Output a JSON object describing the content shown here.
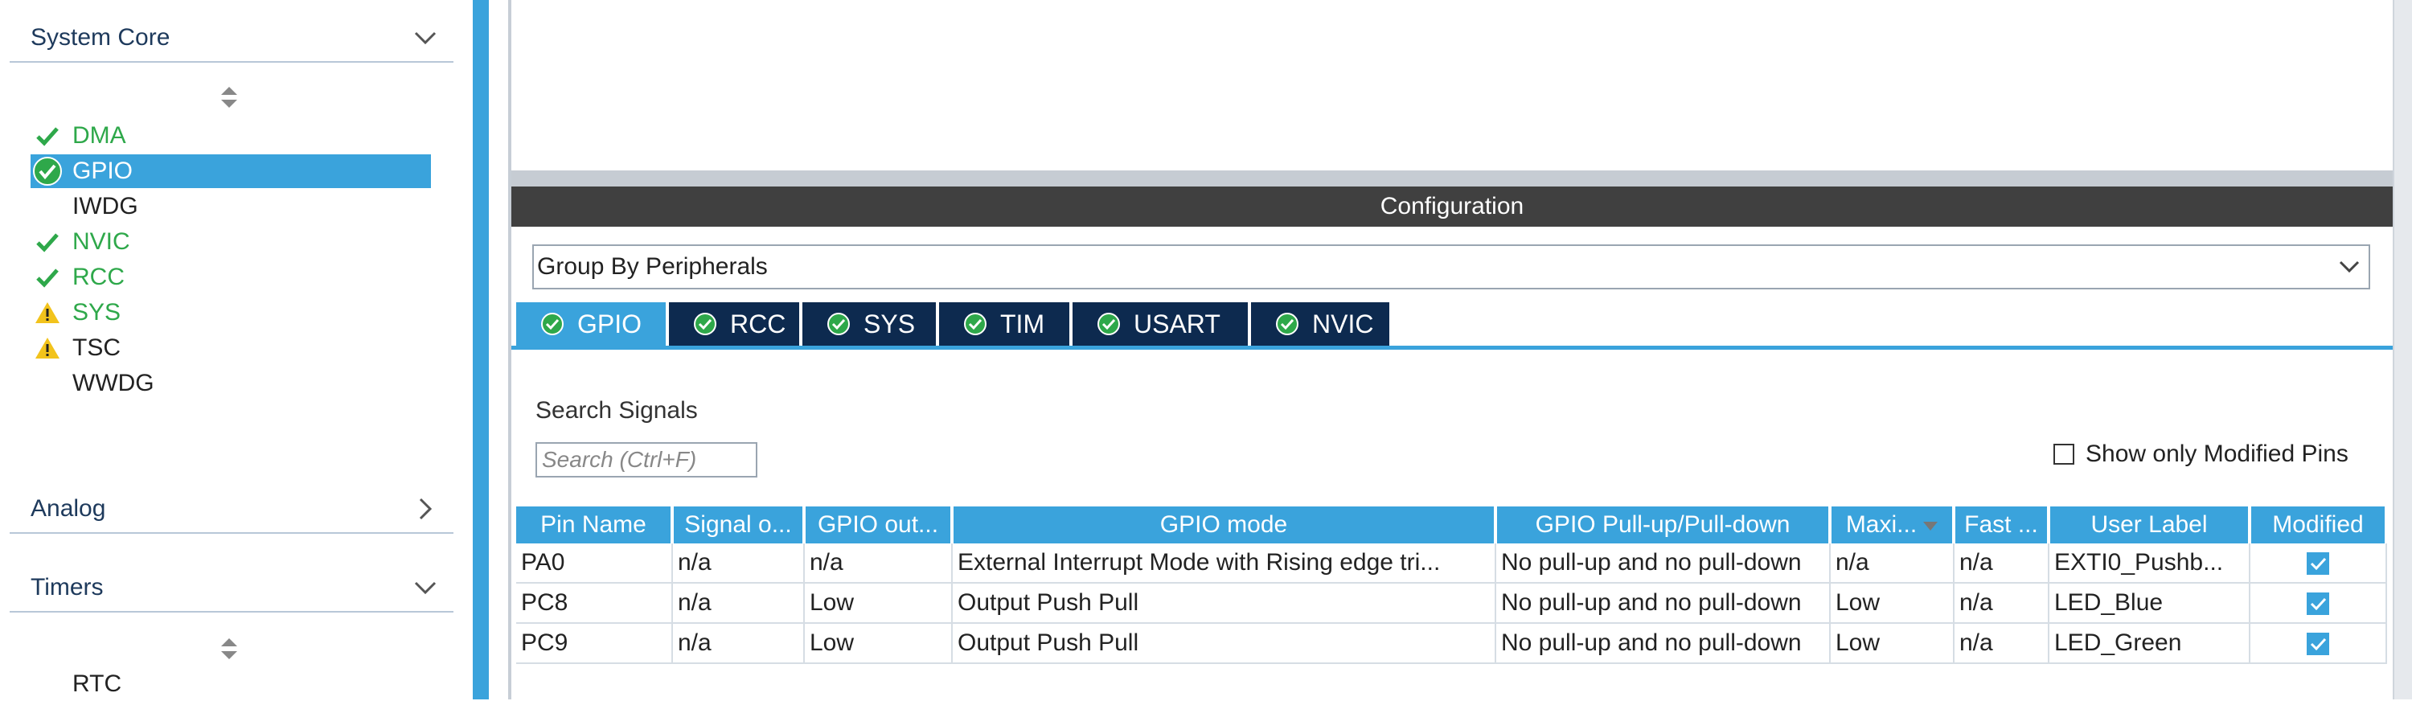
{
  "sidebar": {
    "categories": [
      {
        "label": "System Core",
        "chevron": "chevron-down-icon"
      },
      {
        "label": "Analog",
        "chevron": "chevron-right-icon"
      },
      {
        "label": "Timers",
        "chevron": "chevron-down-icon"
      }
    ],
    "system_core_items": [
      {
        "label": "DMA",
        "status": "check",
        "color": "#2ea84a"
      },
      {
        "label": "GPIO",
        "status": "check-circle",
        "selected": true
      },
      {
        "label": "IWDG",
        "status": "none"
      },
      {
        "label": "NVIC",
        "status": "check",
        "color": "#2ea84a"
      },
      {
        "label": "RCC",
        "status": "check",
        "color": "#2ea84a"
      },
      {
        "label": "SYS",
        "status": "warning",
        "color": "#2ea84a"
      },
      {
        "label": "TSC",
        "status": "warning"
      },
      {
        "label": "WWDG",
        "status": "none"
      }
    ],
    "timers_items": [
      {
        "label": "RTC",
        "status": "none"
      }
    ]
  },
  "config": {
    "title": "Configuration",
    "group_by": "Group By Peripherals",
    "tabs": [
      "GPIO",
      "RCC",
      "SYS",
      "TIM",
      "USART",
      "NVIC"
    ],
    "active_tab": "GPIO",
    "search_label": "Search Signals",
    "search_placeholder": "Search (Ctrl+F)",
    "modified_only_label": "Show only Modified Pins"
  },
  "table": {
    "headers": [
      "Pin Name",
      "Signal o...",
      "GPIO out...",
      "GPIO mode",
      "GPIO Pull-up/Pull-down",
      "Maxi...",
      "Fast ...",
      "User Label",
      "Modified"
    ],
    "rows": [
      [
        "PA0",
        "n/a",
        "n/a",
        "External Interrupt Mode with Rising edge tri...",
        "No pull-up and no pull-down",
        "n/a",
        "n/a",
        "EXTI0_Pushb...",
        true
      ],
      [
        "PC8",
        "n/a",
        "Low",
        "Output Push Pull",
        "No pull-up and no pull-down",
        "Low",
        "n/a",
        "LED_Blue",
        true
      ],
      [
        "PC9",
        "n/a",
        "Low",
        "Output Push Pull",
        "No pull-up and no pull-down",
        "Low",
        "n/a",
        "LED_Green",
        true
      ]
    ]
  },
  "colors": {
    "accent": "#3aa3dc",
    "tab_dark": "#0d2a4f",
    "ok_green": "#2ea84a",
    "warning": "#f2c31c"
  }
}
